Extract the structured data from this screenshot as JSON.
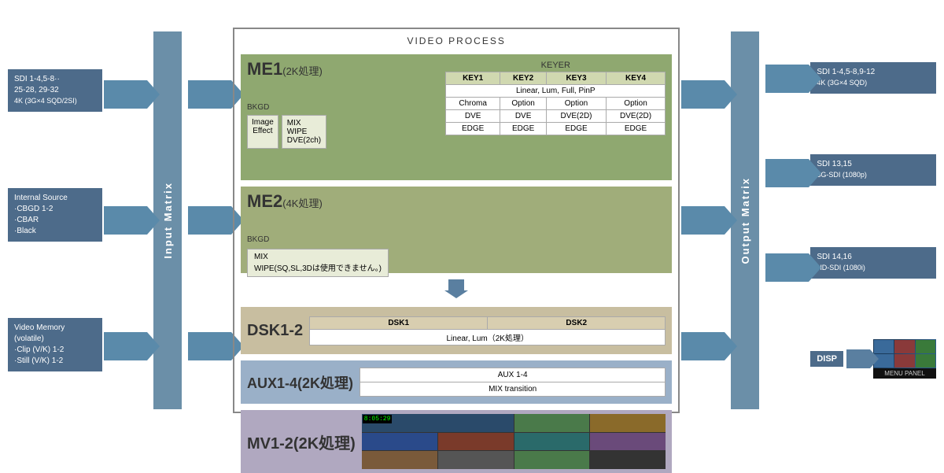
{
  "title": "VIDEO PROCESS",
  "left_inputs": [
    {
      "id": "sdi-input",
      "lines": [
        "SDI 1-4,5-8··",
        "25-28, 29-32",
        "4K (3G×4 SQD/2SI)"
      ]
    },
    {
      "id": "internal-source",
      "lines": [
        "Internal Source",
        "·CBGD 1-2",
        "·CBAR",
        "·Black"
      ]
    },
    {
      "id": "video-memory",
      "lines": [
        "Video Memory",
        "(volatile)",
        "·Clip (V/K) 1-2",
        "·Still (V/K) 1-2"
      ]
    }
  ],
  "input_matrix_label": "Input Matrix",
  "output_matrix_label": "Output Matrix",
  "me1": {
    "title": "ME1",
    "subtitle": "(2K処理)",
    "keyer": {
      "label": "KEYER",
      "headers": [
        "KEY1",
        "KEY2",
        "KEY3",
        "KEY4"
      ],
      "row_linear": "Linear, Lum, Full, PinP",
      "row_options": [
        "Chroma",
        "Option",
        "Option",
        "Option"
      ],
      "row_dve": [
        "DVE",
        "DVE",
        "DVE(2D)",
        "DVE(2D)"
      ],
      "row_edge": [
        "EDGE",
        "EDGE",
        "EDGE",
        "EDGE"
      ]
    },
    "bkgd_label": "BKGD",
    "image_effect_label": "Image\nEffect",
    "mix_wipe_dve": "MIX\nWIPE\nDVE(2ch)"
  },
  "me2": {
    "title": "ME2",
    "subtitle": "(4K処理)",
    "bkgd_label": "BKGD",
    "mix_wipe": "MIX\nWIPE(SQ,SL,3Dは使用できません。)"
  },
  "dsk": {
    "title": "DSK1-2",
    "headers": [
      "DSK1",
      "DSK2"
    ],
    "row_linear": "Linear, Lum（2K処理）"
  },
  "aux": {
    "title": "AUX1-4(2K処理)",
    "row1": "AUX 1-4",
    "row2": "MIX transition"
  },
  "mv": {
    "title": "MV1-2(2K処理)",
    "timer": "8:05:29"
  },
  "right_outputs": [
    {
      "id": "sdi-1-output",
      "lines": [
        "SDI 1-4,5-8,9-12",
        "4K (3G×4 SQD)"
      ]
    },
    {
      "id": "sdi-13-output",
      "lines": [
        "SDI 13,15",
        "3G-SDI (1080p)"
      ]
    },
    {
      "id": "sdi-14-output",
      "lines": [
        "SDI 14,16",
        "HD-SDI (1080i)"
      ]
    }
  ],
  "disp_label": "DISP",
  "menu_panel_label": "MENU PANEL"
}
